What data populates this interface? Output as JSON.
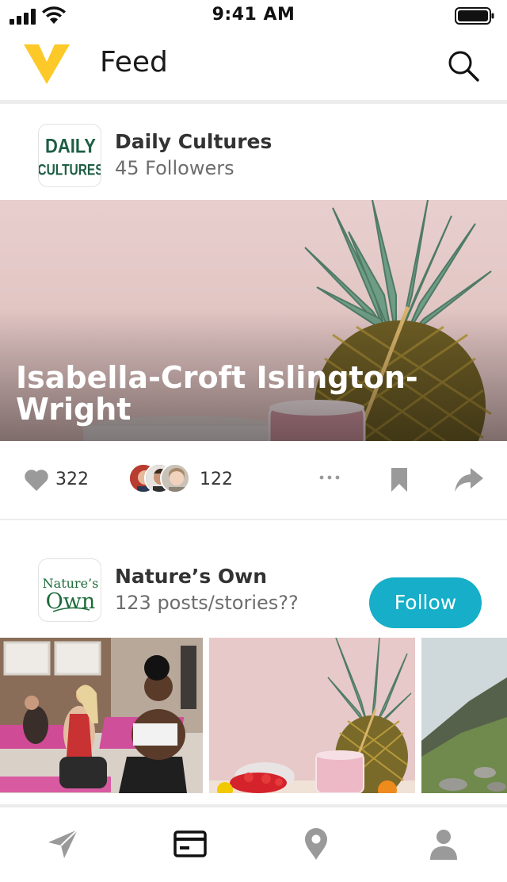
{
  "status_bar": {
    "time": "9:41 AM"
  },
  "header": {
    "title": "Feed"
  },
  "post_1": {
    "author": "Daily Cultures",
    "followers": "45 Followers",
    "logo_text": [
      "DAILY",
      "CULTURES"
    ],
    "headline": "Isabella-Croft Islington-Wright",
    "likes": "322",
    "comments": "122"
  },
  "post_2": {
    "author": "Nature’s Own",
    "meta": "123 posts/stories??",
    "logo_text": [
      "Nature’s",
      "Own"
    ],
    "follow_label": "Follow"
  },
  "tabs": [
    "send-icon",
    "feed-icon",
    "location-pin-icon",
    "profile-icon"
  ],
  "colors": {
    "accent": "#16aec8",
    "logo_yellow": "#fcc928",
    "active_tab": "#111111",
    "inactive_tab": "#9a9a9a"
  }
}
